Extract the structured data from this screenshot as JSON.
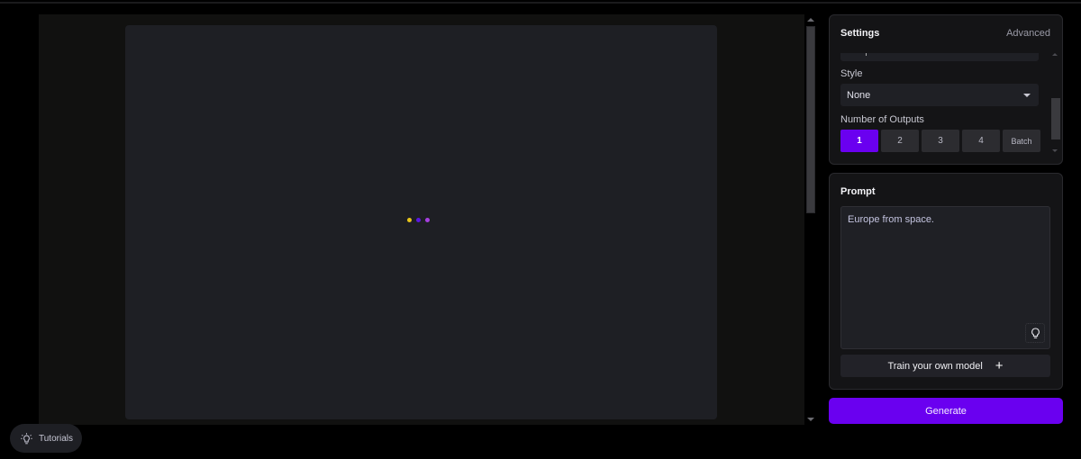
{
  "canvas": {
    "loader_colors": [
      "#e8c51a",
      "#5a18e0",
      "#a640e0"
    ]
  },
  "settings": {
    "title": "Settings",
    "advanced_label": "Advanced",
    "style": {
      "label": "Style",
      "selected": "None"
    },
    "outputs": {
      "label": "Number of Outputs",
      "options": [
        "1",
        "2",
        "3",
        "4",
        "Batch"
      ],
      "selected": "1"
    }
  },
  "prompt": {
    "title": "Prompt",
    "value": "Europe from space.",
    "train_label": "Train your own model",
    "train_icon": "plus-icon",
    "suggest_icon": "lightbulb-icon"
  },
  "generate_label": "Generate",
  "tutorials_label": "Tutorials",
  "colors": {
    "accent": "#6a00f0",
    "panel": "#141416",
    "canvas": "#1e1f24"
  }
}
